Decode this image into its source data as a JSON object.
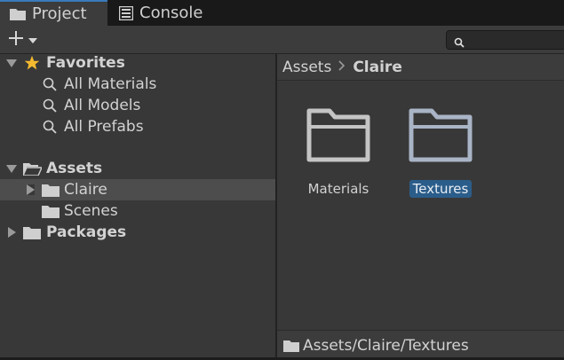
{
  "tabs": [
    {
      "label": "Project",
      "icon": "folder-icon",
      "active": true
    },
    {
      "label": "Console",
      "icon": "console-icon",
      "active": false
    }
  ],
  "toolbar": {
    "create_icon": "plus-icon",
    "dropdown_icon": "chevron-down-icon",
    "search_icon": "search-icon"
  },
  "tree": {
    "favorites": {
      "label": "Favorites",
      "items": [
        "All Materials",
        "All Models",
        "All Prefabs"
      ]
    },
    "assets": {
      "label": "Assets",
      "children": [
        {
          "label": "Claire",
          "selected": true
        },
        {
          "label": "Scenes"
        }
      ]
    },
    "packages": {
      "label": "Packages"
    }
  },
  "breadcrumb": {
    "root": "Assets",
    "current": "Claire"
  },
  "grid": [
    {
      "label": "Materials",
      "selected": false
    },
    {
      "label": "Textures",
      "selected": true
    }
  ],
  "status": {
    "path": "Assets/Claire/Textures"
  },
  "colors": {
    "selection": "#2b5d8a",
    "tab_accent": "#3a79bb",
    "star": "#f4b92f"
  }
}
